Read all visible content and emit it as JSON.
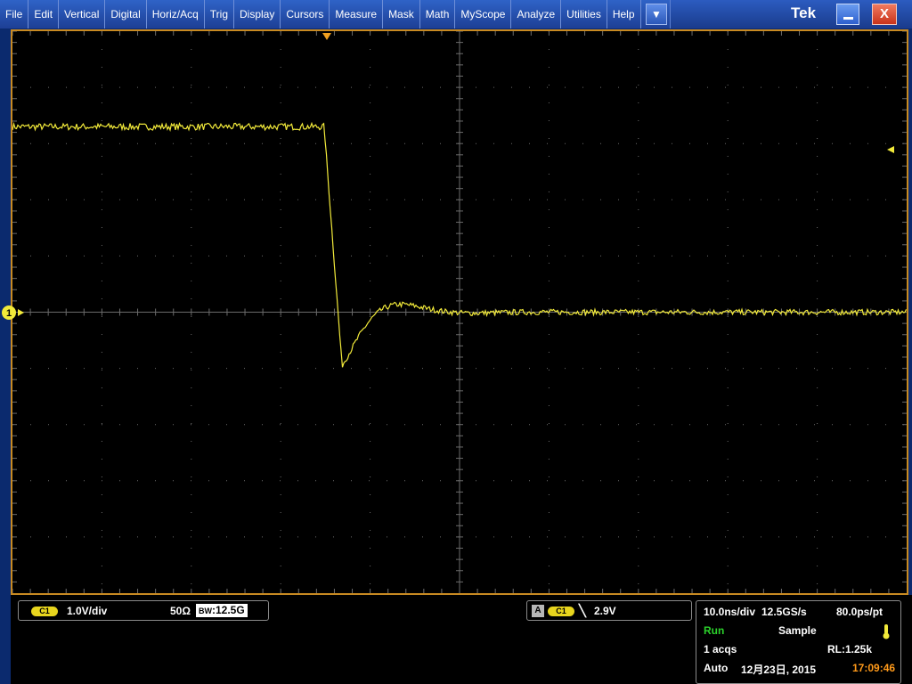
{
  "menu": [
    "File",
    "Edit",
    "Vertical",
    "Digital",
    "Horiz/Acq",
    "Trig",
    "Display",
    "Cursors",
    "Measure",
    "Mask",
    "Math",
    "MyScope",
    "Analyze",
    "Utilities",
    "Help"
  ],
  "title_bar": {
    "dropdown_glyph": "▼",
    "logo": "Tek",
    "close_glyph": "X"
  },
  "colors": {
    "trace": "#f2ea3a",
    "frame": "#c88a22",
    "grid": "#6b6b6b",
    "menu": "#2448a8"
  },
  "waveform": {
    "trigger_position_marker": "▼",
    "trigger_level_marker": "◄",
    "channel_marker": "1",
    "levels_div": {
      "high": 3.3,
      "baseline": 0.0,
      "undershoot_min": -0.95
    }
  },
  "channel_readout": {
    "badge": "C1",
    "scale": "1.0V/div",
    "termination": "50Ω",
    "bandwidth_prefix": "BW",
    "bandwidth": ":12.5G"
  },
  "trigger_readout": {
    "source_letter": "A",
    "badge": "C1",
    "slope": "╲",
    "level": "2.9V"
  },
  "acq_readout": {
    "timebase": "10.0ns/div",
    "sample_rate": "12.5GS/s",
    "resolution": "80.0ps/pt",
    "status": "Run",
    "mode": "Sample",
    "acqs": "1 acqs",
    "record_length": "RL:1.25k",
    "trigger_mode": "Auto",
    "date": "12月23日, 2015",
    "time": "17:09:46",
    "status_color": "#2bd12b",
    "time_color": "#ff9a1a"
  }
}
